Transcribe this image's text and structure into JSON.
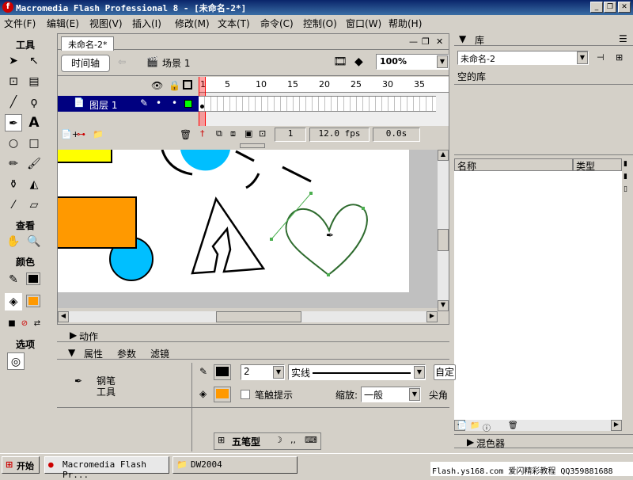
{
  "window": {
    "title": "Macromedia Flash Professional 8 - [未命名-2*]",
    "minimize": "_",
    "restore": "❐",
    "close": "✕"
  },
  "menu": [
    "文件(F)",
    "编辑(E)",
    "视图(V)",
    "插入(I)",
    "修改(M)",
    "文本(T)",
    "命令(C)",
    "控制(O)",
    "窗口(W)",
    "帮助(H)"
  ],
  "toolbox": {
    "title": "工具",
    "view_title": "查看",
    "color_title": "颜色",
    "options_title": "选项",
    "stroke_color": "#000000",
    "fill_color": "#ff9900"
  },
  "document": {
    "tab_label": "未命名-2*",
    "timeline_button": "时间轴",
    "scene_label": "场景 1",
    "zoom": "100%",
    "layer_name": "图层 1",
    "frame_numbers": [
      "1",
      "5",
      "10",
      "15",
      "20",
      "25",
      "30",
      "35"
    ],
    "current_frame": "1",
    "frame_rate": "12.0 fps",
    "elapsed_time": "0.0s"
  },
  "library": {
    "panel_title": "库",
    "selected_doc": "未命名-2",
    "empty_text": "空的库",
    "col_name": "名称",
    "col_type": "类型",
    "mixer_title": "混色器"
  },
  "properties": {
    "actions_title": "动作",
    "tab_properties": "属性",
    "tab_parameters": "参数",
    "tab_filters": "滤镜",
    "tool_name_line1": "钢笔",
    "tool_name_line2": "工具",
    "stroke_width": "2",
    "stroke_style": "实线",
    "custom_button": "自定",
    "stroke_hint_label": "笔触提示",
    "scale_label": "缩放:",
    "scale_value": "一般",
    "cap_label": "尖角",
    "stroke_color": "#000000",
    "fill_color": "#ff9900"
  },
  "ime": {
    "label": "五笔型"
  },
  "taskbar": {
    "start": "开始",
    "tasks": [
      "Macromedia Flash Pr...",
      "DW2004"
    ],
    "watermark": "Flash.ys168.com 爱闪精彩教程 QQ359881688"
  },
  "colors": {
    "accent_cyan": "#00bfff",
    "accent_orange": "#ff9900",
    "accent_yellow": "#ffff00",
    "path_green": "#4caf50"
  }
}
